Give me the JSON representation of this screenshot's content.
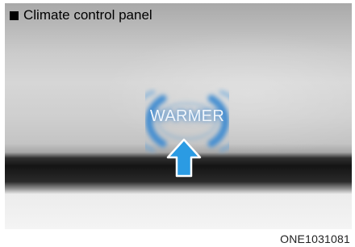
{
  "caption": {
    "title": "Climate control panel"
  },
  "panel": {
    "button_label": "WARMER",
    "glow_color": "#3d8ad1",
    "arrow_color": "#2b9be3"
  },
  "figure": {
    "code": "ONE1031081"
  }
}
